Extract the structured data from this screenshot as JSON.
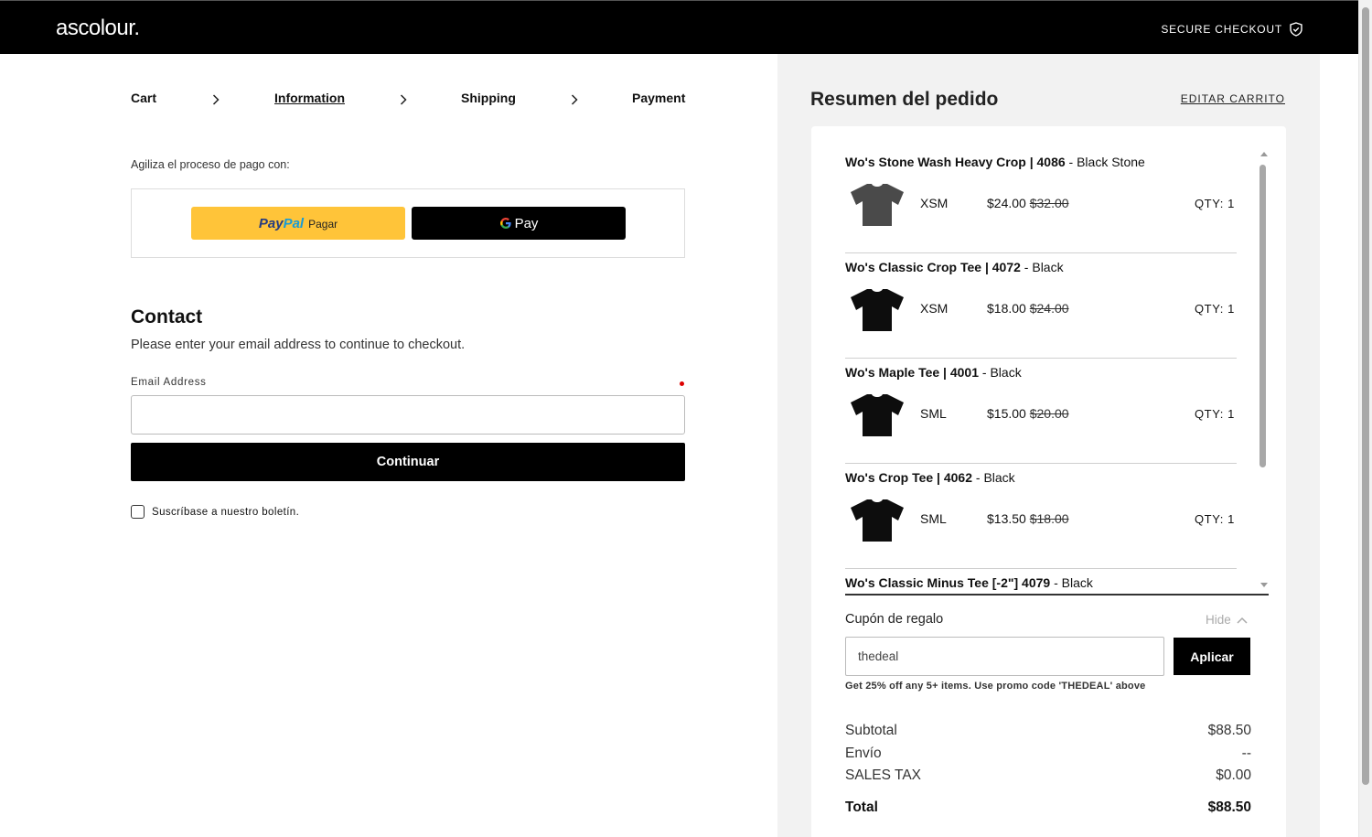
{
  "header": {
    "logo": "ascolour.",
    "secure_checkout": "SECURE CHECKOUT"
  },
  "breadcrumb": [
    "Cart",
    "Information",
    "Shipping",
    "Payment"
  ],
  "express": {
    "label": "Agiliza el proceso de pago con:",
    "paypal_part1": "Pay",
    "paypal_part2": "Pal",
    "paypal_label": "Pagar",
    "gpay_label": "Pay"
  },
  "contact": {
    "title": "Contact",
    "description": "Please enter your email address to continue to checkout.",
    "email_label": "Email Address",
    "email_value": "",
    "continue_label": "Continuar",
    "newsletter_label": "Suscríbase a nuestro boletín."
  },
  "summary": {
    "title": "Resumen del pedido",
    "edit_cart": "EDITAR CARRITO",
    "items": [
      {
        "name": "Wo's Stone Wash Heavy Crop | 4086",
        "color": " - Black Stone",
        "size": "XSM",
        "price": "$24.00",
        "compare_price": "$32.00",
        "qty": "QTY: 1",
        "swatch": "#4a4a4a"
      },
      {
        "name": "Wo's Classic Crop Tee | 4072",
        "color": " - Black",
        "size": "XSM",
        "price": "$18.00",
        "compare_price": "$24.00",
        "qty": "QTY: 1",
        "swatch": "#0d0d0d"
      },
      {
        "name": "Wo's Maple Tee | 4001",
        "color": " - Black",
        "size": "SML",
        "price": "$15.00",
        "compare_price": "$20.00",
        "qty": "QTY: 1",
        "swatch": "#0d0d0d"
      },
      {
        "name": "Wo's Crop Tee | 4062",
        "color": " - Black",
        "size": "SML",
        "price": "$13.50",
        "compare_price": "$18.00",
        "qty": "QTY: 1",
        "swatch": "#0d0d0d"
      },
      {
        "name": "Wo's Classic Minus Tee [-2\"] 4079",
        "color": " - Black",
        "size": "",
        "price": "",
        "compare_price": "",
        "qty": "",
        "swatch": "#0d0d0d"
      }
    ],
    "coupon": {
      "label": "Cupón de regalo",
      "hide": "Hide",
      "value": "thedeal",
      "apply": "Aplicar",
      "note": "Get 25% off any 5+ items. Use promo code 'THEDEAL' above"
    },
    "totals": {
      "subtotal_label": "Subtotal",
      "subtotal": "$88.50",
      "shipping_label": "Envío",
      "shipping": "--",
      "tax_label": "SALES TAX",
      "tax": "$0.00",
      "total_label": "Total",
      "total": "$88.50"
    }
  }
}
